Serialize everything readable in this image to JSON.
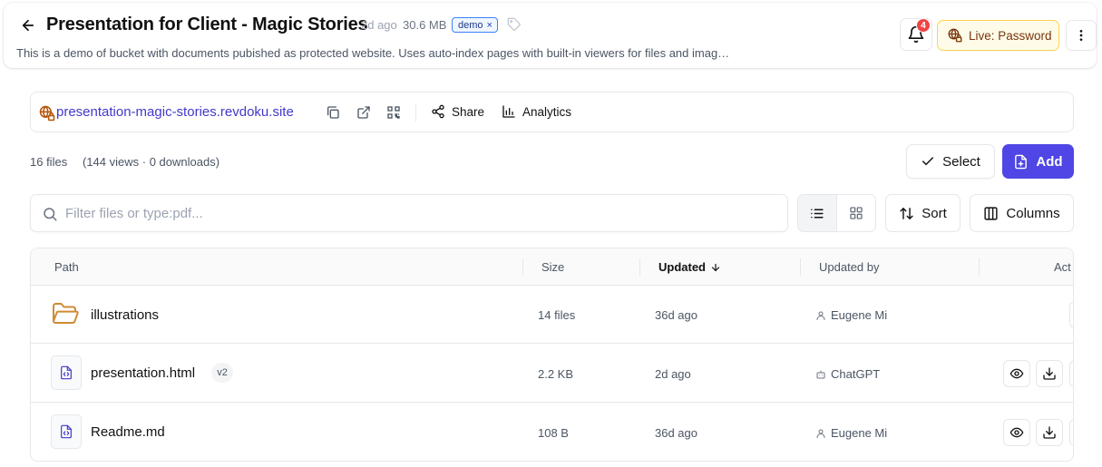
{
  "header": {
    "title": "Presentation for Client - Magic Stories",
    "updated": "2d ago",
    "size": "30.6 MB",
    "tag": "demo",
    "tag_remove": "×",
    "description": "This is a demo of bucket with documents pubished as protected website. Uses auto-index pages with built-in viewers for files and imag…",
    "notifications_count": "4",
    "live_label": "Live: Password"
  },
  "site": {
    "url": "presentation-magic-stories.revdoku.site",
    "share_label": "Share",
    "analytics_label": "Analytics"
  },
  "stats": {
    "files": "16 files",
    "views": "(144 views · 0 downloads)"
  },
  "actions": {
    "select_label": "Select",
    "add_label": "Add"
  },
  "filter": {
    "placeholder": "Filter files or type:pdf..."
  },
  "toolbar": {
    "sort_label": "Sort",
    "columns_label": "Columns"
  },
  "table": {
    "columns": {
      "path": "Path",
      "size": "Size",
      "updated": "Updated",
      "updated_by": "Updated by",
      "actions": "Act"
    },
    "rows": [
      {
        "name": "illustrations",
        "type": "folder",
        "size": "14 files",
        "updated": "36d ago",
        "by": "Eugene Mi",
        "by_type": "user"
      },
      {
        "name": "presentation.html",
        "type": "file",
        "version": "v2",
        "size": "2.2 KB",
        "updated": "2d ago",
        "by": "ChatGPT",
        "by_type": "bot"
      },
      {
        "name": "Readme.md",
        "type": "file",
        "size": "108 B",
        "updated": "36d ago",
        "by": "Eugene Mi",
        "by_type": "user"
      }
    ]
  },
  "colors": {
    "accent": "#4f46e5",
    "link": "#4338ca",
    "tag_border": "#3b82f6",
    "live_bg": "#fefce8",
    "live_border": "#fcd34d",
    "badge": "#ef4444",
    "folder": "#d08b34"
  }
}
